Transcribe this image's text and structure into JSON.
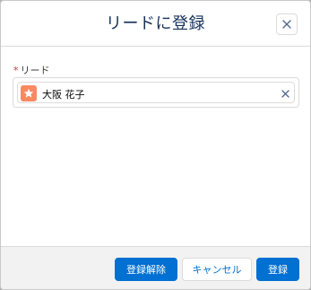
{
  "modal": {
    "title": "リードに登録",
    "close_label": "×"
  },
  "field": {
    "required_mark": "*",
    "label": "リード",
    "selected_record": "大阪 花子",
    "record_icon": "lead-star-icon",
    "accent_color": "#f88962"
  },
  "footer": {
    "deregister_label": "登録解除",
    "cancel_label": "キャンセル",
    "register_label": "登録"
  },
  "colors": {
    "brand": "#0070d2",
    "title": "#16325c",
    "required": "#c23934"
  }
}
